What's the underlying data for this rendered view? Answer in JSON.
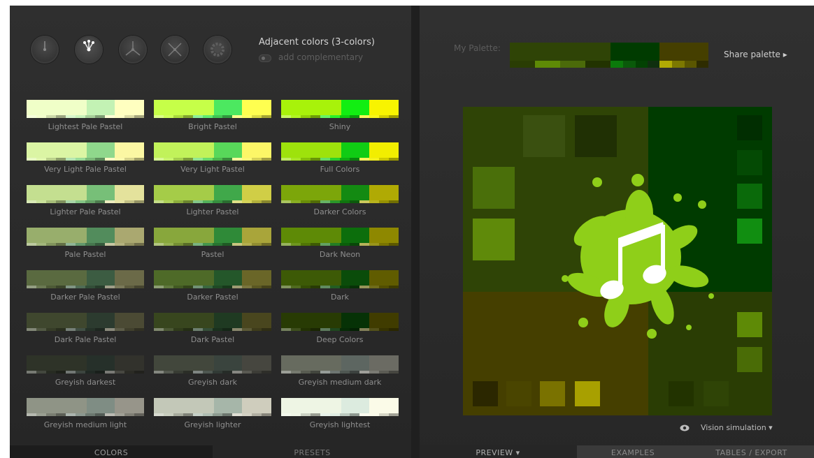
{
  "scheme": {
    "title": "Adjacent colors (3-colors)",
    "complementary_label": "add complementary"
  },
  "presets": [
    {
      "label": "Lightest Pale Pastel",
      "colors": [
        "#f0ffc8",
        "#c3f2b4",
        "#ffffc0"
      ]
    },
    {
      "label": "Bright Pastel",
      "colors": [
        "#c6ff48",
        "#4ce860",
        "#ffff50"
      ]
    },
    {
      "label": "Shiny",
      "colors": [
        "#a8f20a",
        "#12ee12",
        "#f8f400"
      ]
    },
    {
      "label": "Very Light Pale Pastel",
      "colors": [
        "#dbf5a4",
        "#8fd88c",
        "#fbf7a3"
      ]
    },
    {
      "label": "Very Light Pastel",
      "colors": [
        "#c1f25a",
        "#58d85a",
        "#fcf667"
      ]
    },
    {
      "label": "Full Colors",
      "colors": [
        "#9ee20c",
        "#10cc14",
        "#f2ee00"
      ]
    },
    {
      "label": "Lighter Pale Pastel",
      "colors": [
        "#c4df90",
        "#77bf78",
        "#e4e29c"
      ]
    },
    {
      "label": "Lighter Pastel",
      "colors": [
        "#a5cc48",
        "#40a84a",
        "#d0ce46"
      ]
    },
    {
      "label": "Darker Colors",
      "colors": [
        "#7ca60a",
        "#138a12",
        "#b0aa04"
      ]
    },
    {
      "label": "Pale Pastel",
      "colors": [
        "#98ae6c",
        "#528c5c",
        "#aaa870"
      ]
    },
    {
      "label": "Pastel",
      "colors": [
        "#88a73c",
        "#2f8a38",
        "#a9a53a"
      ]
    },
    {
      "label": "Dark Neon",
      "colors": [
        "#5e8a06",
        "#0c6e0c",
        "#8e8800"
      ]
    },
    {
      "label": "Darker Pale Pastel",
      "colors": [
        "#5a6a40",
        "#3c5c42",
        "#6b6a48"
      ]
    },
    {
      "label": "Darker Pastel",
      "colors": [
        "#4e6a28",
        "#24572a",
        "#6a6628"
      ]
    },
    {
      "label": "Dark",
      "colors": [
        "#3d5a06",
        "#0a4c0a",
        "#605c00"
      ]
    },
    {
      "label": "Dark Pale Pastel",
      "colors": [
        "#3f472e",
        "#2c3b2f",
        "#4b4a34"
      ]
    },
    {
      "label": "Dark Pastel",
      "colors": [
        "#38461e",
        "#1f3a22",
        "#49461e"
      ]
    },
    {
      "label": "Deep Colors",
      "colors": [
        "#283b04",
        "#063206",
        "#403c00"
      ]
    },
    {
      "label": "Greyish darkest",
      "colors": [
        "#2e3328",
        "#26302a",
        "#32322c"
      ]
    },
    {
      "label": "Greyish dark",
      "colors": [
        "#42473c",
        "#3a443e",
        "#46463f"
      ]
    },
    {
      "label": "Greyish medium dark",
      "colors": [
        "#676b5f",
        "#5d6661",
        "#6b6b63"
      ]
    },
    {
      "label": "Greyish medium light",
      "colors": [
        "#8f9486",
        "#7f8d84",
        "#97958a"
      ]
    },
    {
      "label": "Greyish lighter",
      "colors": [
        "#c3c8b8",
        "#a6b6a9",
        "#cfcdbd"
      ]
    },
    {
      "label": "Greyish lightest",
      "colors": [
        "#eef5e4",
        "#dcebdf",
        "#fbfbe8"
      ]
    }
  ],
  "palette": {
    "label": "My Palette:",
    "share_label": "Share palette ▸",
    "colors": [
      "#2f4406",
      "#003b00",
      "#453f00"
    ],
    "shades": [
      "#2a3d04",
      "#5e8a06",
      "#4b6a0a",
      "#223300",
      "#0b7a0b",
      "#0a5a0a",
      "#034203",
      "#0f2f0f",
      "#b0aa04",
      "#7c7800",
      "#5a5600",
      "#2e2c00"
    ]
  },
  "preview": {
    "quadrants": [
      "#2f4406",
      "#003b00",
      "#453f00",
      "#2a3d04"
    ],
    "vision_label": "Vision simulation ▾"
  },
  "tabs": {
    "colors": "COLORS",
    "presets": "PRESETS",
    "preview": "PREVIEW ▾",
    "examples": "EXAMPLES",
    "tables": "TABLES / EXPORT"
  },
  "accent": "#8fcf19"
}
